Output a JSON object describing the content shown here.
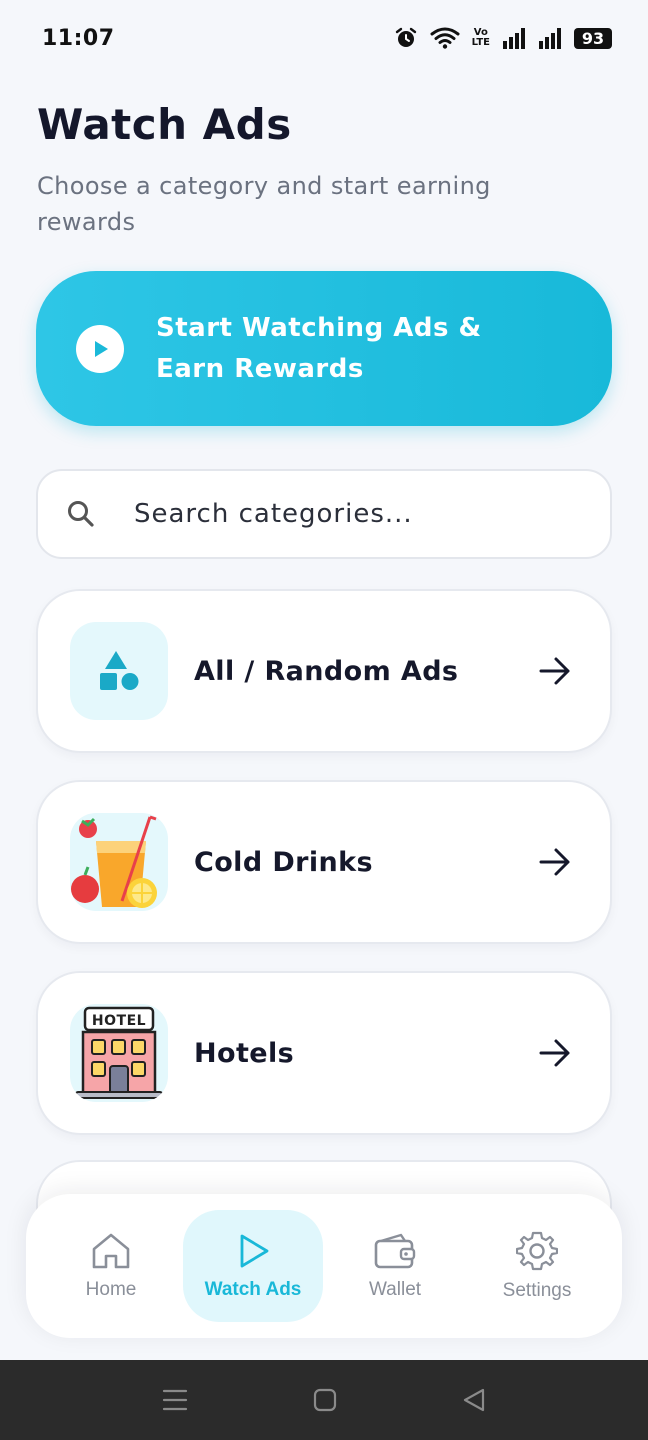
{
  "status_bar": {
    "time": "11:07",
    "volte_top": "Vo",
    "volte_bottom": "LTE",
    "battery": "93",
    "icons": [
      "alarm-icon",
      "wifi-icon",
      "volte-icon",
      "signal-icon",
      "signal-icon",
      "battery-icon"
    ]
  },
  "header": {
    "title": "Watch Ads",
    "subtitle": "Choose a category and start earning rewards"
  },
  "cta": {
    "label": "Start Watching Ads & Earn Rewards",
    "icon": "play-icon"
  },
  "search": {
    "placeholder": "Search categories...",
    "value": "",
    "icon": "search-icon"
  },
  "categories": [
    {
      "label": "All / Random Ads",
      "icon": "shapes-icon"
    },
    {
      "label": "Cold Drinks",
      "icon": "cold-drink-icon"
    },
    {
      "label": "Hotels",
      "icon": "hotel-icon",
      "icon_text": "HOTEL"
    }
  ],
  "bottom_nav": {
    "items": [
      {
        "label": "Home",
        "icon": "home-icon",
        "active": false
      },
      {
        "label": "Watch Ads",
        "icon": "play-outline-icon",
        "active": true
      },
      {
        "label": "Wallet",
        "icon": "wallet-icon",
        "active": false
      },
      {
        "label": "Settings",
        "icon": "gear-icon",
        "active": false
      }
    ]
  },
  "system_nav": [
    "menu-icon",
    "home-square-icon",
    "back-triangle-icon"
  ],
  "colors": {
    "accent": "#19b8d8",
    "accent_light": "#e0f7fc",
    "title": "#14172b",
    "muted": "#6b7280",
    "background": "#f5f7fb"
  }
}
